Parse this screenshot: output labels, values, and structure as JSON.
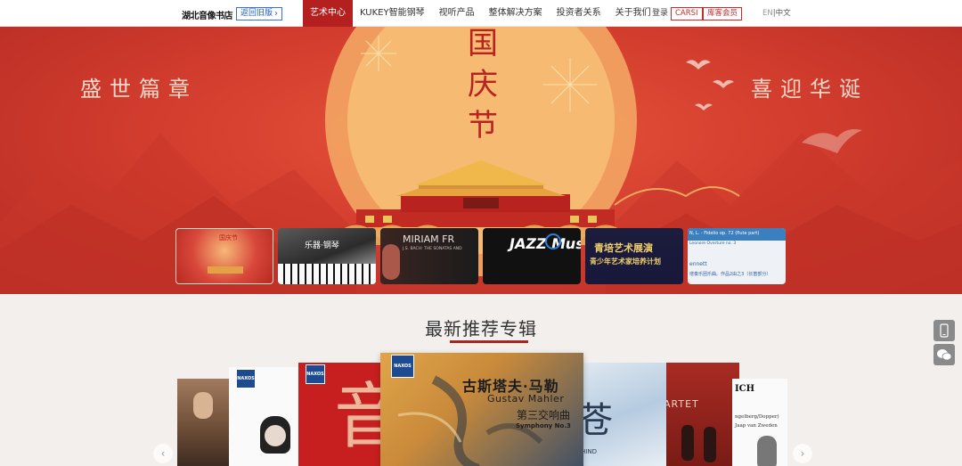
{
  "header": {
    "logo_text": "湖北音像书店",
    "old_version_label": "返回旧版",
    "old_version_icon": "chevron-right-icon",
    "nav": [
      {
        "label": "艺术中心",
        "active": true
      },
      {
        "label": "KUKEY智能钢琴",
        "active": false
      },
      {
        "label": "视听产品",
        "active": false
      },
      {
        "label": "整体解决方案",
        "active": false
      },
      {
        "label": "投资者关系",
        "active": false
      },
      {
        "label": "关于我们",
        "active": false
      }
    ],
    "login_label": "登录",
    "carsi_label": "CARSI",
    "member_label": "库客会员",
    "lang_en": "EN",
    "lang_sep": "|",
    "lang_cn": "中文",
    "accent_color": "#b41f1f"
  },
  "banner": {
    "slogan_left": "盛世篇章",
    "slogan_right": "喜迎华诞",
    "vertical_text": [
      "国",
      "庆",
      "节"
    ],
    "thumbnails": [
      {
        "text": "国庆节",
        "active": true
      },
      {
        "text": "乐器·钢琴",
        "active": false
      },
      {
        "text": "MIRIAM FR",
        "sub": "J.S. BACH: THE SONATAS AND",
        "active": false
      },
      {
        "text": "JAZZ Music",
        "active": false
      },
      {
        "text": "青培艺术展演",
        "sub": "青少年艺术家培养计划",
        "active": false
      },
      {
        "text": "N, L. - Fidelio op. 72 (flute part)",
        "sub": "Leonore Overture no. 3",
        "extra": "ennett",
        "extra2": "增奏乐团乐曲。作品2由之3（长笛部分）",
        "active": false
      }
    ]
  },
  "section": {
    "title": "最新推荐专辑"
  },
  "albums": [
    {
      "name": "album-portrait"
    },
    {
      "name": "album-naxos-pianist"
    },
    {
      "name": "album-red-calligraphy",
      "text": "音"
    },
    {
      "name": "album-mahler",
      "title_cn": "古斯塔夫·马勒",
      "title_en": "Gustav Mahler",
      "work_cn": "第三交响曲",
      "work_en": "Symphony No.3"
    },
    {
      "name": "album-blue-ink",
      "text": "苍",
      "sub": "HIND"
    },
    {
      "name": "album-quartet",
      "text": "ARTET"
    },
    {
      "name": "album-ich",
      "text": "ICH",
      "sub": "ngelberg/Dopper)",
      "sub2": "Jaap van Zweden"
    }
  ],
  "logo_badge": "NAXOS",
  "side_icons": [
    "mobile-icon",
    "wechat-icon"
  ],
  "arrows": {
    "left": "‹",
    "right": "›"
  }
}
